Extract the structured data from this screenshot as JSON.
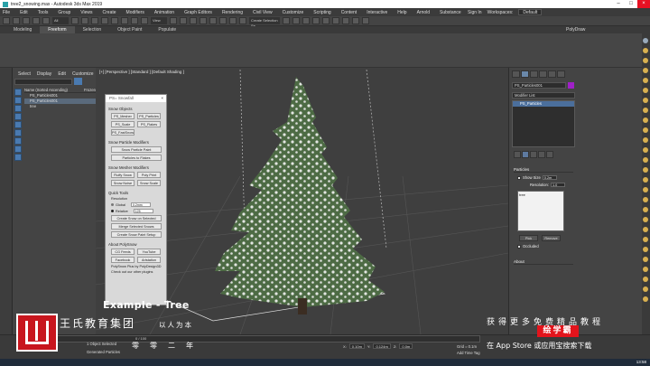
{
  "window": {
    "title": "tree2_snowing.max - Autodesk 3ds Max 2019"
  },
  "menu": [
    "File",
    "Edit",
    "Tools",
    "Group",
    "Views",
    "Create",
    "Modifiers",
    "Animation",
    "Graph Editors",
    "Rendering",
    "Civil View",
    "Customize",
    "Scripting",
    "Content",
    "Interactive",
    "Help",
    "Arnold",
    "Substance"
  ],
  "signin": {
    "label": "Sign In",
    "workspaces_label": "Workspaces:",
    "workspaces_value": "Default"
  },
  "toolbar": {
    "filter_value": "All",
    "view_value": "View",
    "selection_set": "Create Selection Se"
  },
  "ribbon": {
    "tabs": [
      "Modeling",
      "Freeform",
      "Selection",
      "Object Paint",
      "Populate"
    ],
    "active": "Freeform",
    "right_label": "PolyDraw"
  },
  "scene_explorer": {
    "tabs": [
      "Select",
      "Display",
      "Edit",
      "Customize"
    ],
    "header": "Name (Sorted Ascending)",
    "header_right": "Frozen",
    "rows": [
      "PS_Particles001",
      "PS_Particles001",
      "tree"
    ],
    "selected_index": 1
  },
  "viewport": {
    "label": "[+] [Perspective ] [Standard ] [Default Shading ]"
  },
  "floating_panel": {
    "title": "PS= Snowfall",
    "sections": {
      "snow_objects": "Snow Objects",
      "snow_particle_modifiers": "Snow Particle Modifiers",
      "snow_mesher_modifiers": "Snow Mesher Modifiers",
      "quick_tools": "Quick Tools",
      "about": "About PolySnow"
    },
    "buttons": {
      "ps_mesher": "PS_Mesher",
      "ps_particles": "PS_Particles",
      "ps_scale": "PS_Scale",
      "ps_flakes": "PS_Flakes",
      "ps_fastsnow": "PS_FastSnow",
      "snow_particle_paint": "Snow Particle Paint",
      "particles_to_flakes": "Particles to Flakes",
      "fluffy_snow": "Fluffy Snow",
      "poly_print": "Poly Print",
      "snow_noise": "Snow Noise",
      "snow_scale": "Snow Scale",
      "create_snow_on_selected": "Create Snow on Selected",
      "merge_selected_snows": "Merge Selected Snows",
      "create_snow_paint_setup": "Create Snow Paint Setup",
      "cg_feeds": "CG Feeds",
      "youtube": "YouTube",
      "facebook": "Facebook",
      "artstation": "Artstation"
    },
    "resolution_label": "Resolution",
    "global_label": "Global",
    "global_value": "0.2mm",
    "relative_label": "Relative",
    "relative_value": "125",
    "note1": "PolySnow Plus by PolyDesign3D",
    "note2": "Check out our other plugins"
  },
  "caption": "Example - Tree",
  "command_panel": {
    "object_name": "PS_Particles001",
    "modifier_list": "Modifier List",
    "stack_item": "PS_Particles",
    "rollout_particles": "Particles",
    "show_size_label": "Show Size",
    "show_size_value": "0.2m",
    "resolution_label": "Resolution:",
    "resolution_value": "1.0",
    "list_text": "tree",
    "pick_label": "Pick",
    "remove_label": "Remove",
    "occluded_label": "Occluded",
    "rollout_about": "About"
  },
  "status": {
    "objects_selected": "1 Object Selected",
    "prompt": "Generated Particles",
    "frame_counter": "0 / 100",
    "x_label": "X:",
    "x_value": "0.10m",
    "y_label": "Y:",
    "y_value": "0.124m",
    "z_label": "Z:",
    "z_value": "0.0m",
    "grid": "Grid = 0.1m",
    "add_time_tag": "Add Time Tag",
    "clock": "13:58"
  },
  "watermark": {
    "org_name": "王氏教育集团",
    "slogan": "以人为本",
    "years": "零零二年",
    "tagline": "获得更多免费精品教程",
    "brand": "绘学霸",
    "app_hint": "在 App Store 或应用宝搜索下载"
  },
  "colors": {
    "accent": "#4b6f9c",
    "object_color": "#a020c8",
    "watermark_red": "#c8161e"
  }
}
